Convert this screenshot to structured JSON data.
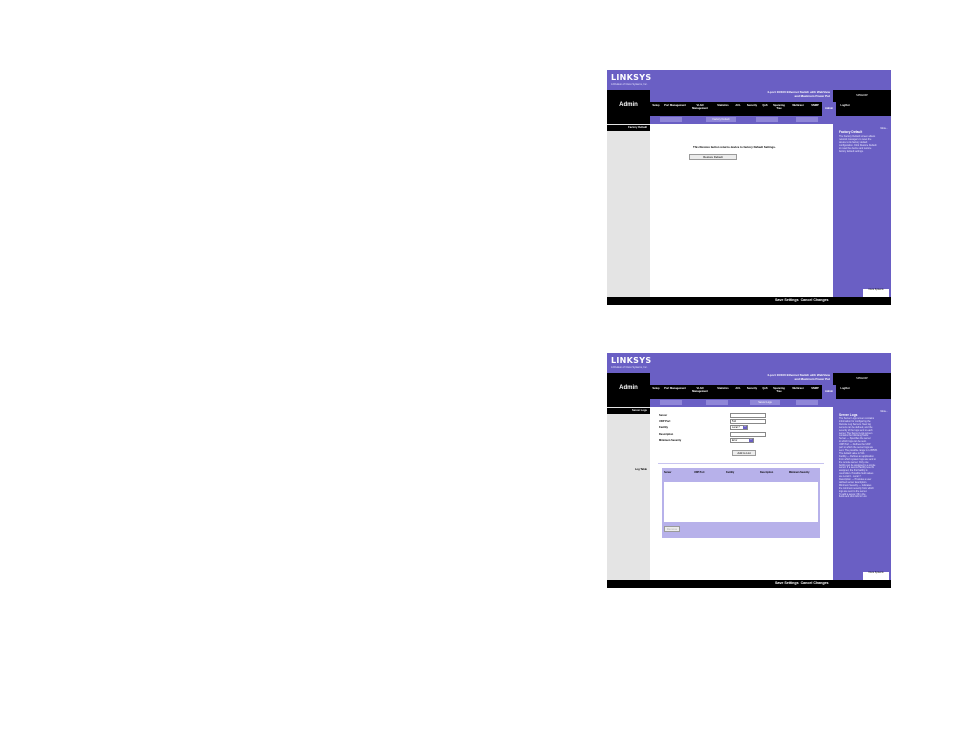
{
  "brand": {
    "logo": "LINKSYS",
    "tagline": "A Division of Cisco Systems, Inc.",
    "cisco_badge": "Cisco Systems",
    "colors": {
      "purple": "#6a5fc4",
      "black": "#000000",
      "light_gray": "#e4e4e4"
    }
  },
  "header": {
    "section": "Admin",
    "product_line1": "4-port 10/100 Ethernet Switch with WebView",
    "product_line2": "and Maximum Power Put",
    "model": "SRW224P"
  },
  "tabs": [
    "Setup",
    "Port Management",
    "VLAN Management",
    "Statistics",
    "ACL",
    "Security",
    "QoS",
    "Spanning Tree",
    "Multicast",
    "SNMP",
    "Admin",
    "LogOut"
  ],
  "active_tab": "Admin",
  "footer": {
    "save": "Save Settings",
    "cancel": "Cancel Changes"
  },
  "screens": [
    {
      "subtabs": [
        "",
        "Factory Default",
        "",
        ""
      ],
      "left_heading": "Factory Default",
      "message": "This Restore button returns device to factory Default Settings.",
      "button": "Restore Default",
      "help_title": "Factory Default",
      "help_text": [
        "The Factory Default screen allows",
        "network managers to reset the",
        "device to its factory default",
        "configuration. Click Restore Default",
        "to reset the device and restore",
        "factory default settings."
      ]
    },
    {
      "subtabs": [
        "",
        "",
        "Server Logs",
        ""
      ],
      "left_heading": "Server Logs",
      "left_label_log_table": "Log Table",
      "form": {
        "server_label": "Server",
        "udp_port_label": "UDP Port",
        "udp_port_value": "514",
        "facility_label": "Facility",
        "facility_value": "Local 7",
        "description_label": "Description",
        "min_severity_label": "Minimum Severity",
        "min_severity_value": "Error",
        "add_button": "Add to List"
      },
      "table_headers": [
        "Server",
        "UDP Port",
        "Facility",
        "Description",
        "Minimum Severity"
      ],
      "remove_button": "Remove",
      "help_title": "Server Logs",
      "help_text": [
        "The Server Logs screen contains",
        "information for configuring the",
        "Remote Log Servers. New log",
        "servers can be defined, and the",
        "severity of the logs sent to each",
        "server. The Server Logs screen",
        "contains the following fields:",
        "Server — Specifies the server",
        "to which logs can be sent.",
        "UDP Port — Defines the UDP",
        "port to which the server logs are",
        "sent. The possible range is 1-65535.",
        "The default value is 514.",
        "Facility — Defines an application",
        "from which system logs are sent to",
        "the remote server. Only one",
        "facility can be assigned to a single",
        "server. If a second facility level is",
        "assigned, the first facility is",
        "overridden. Possible field values",
        "are Local 0 - Local 7.",
        "Description — Provides a user",
        "defined server description.",
        "Minimum Severity — Indicates",
        "the minimum severity from which",
        "logs are sent to the server.",
        "To add a server, fill in the",
        "fields and click Add to List."
      ]
    }
  ]
}
